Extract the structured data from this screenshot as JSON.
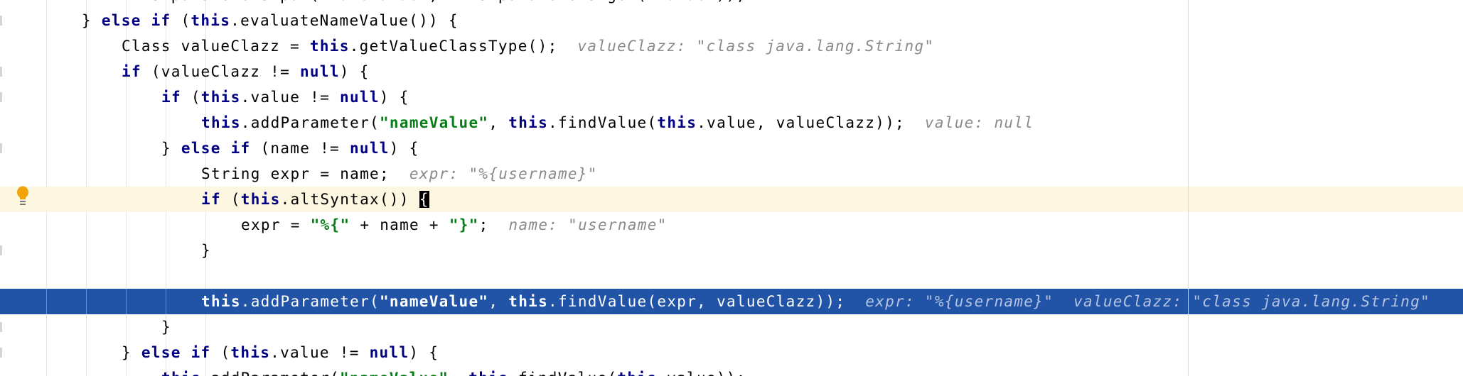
{
  "editor": {
    "lines": [
      {
        "indent": 2,
        "tokens": [
          {
            "s": "kw",
            "t": "this"
          },
          {
            "s": "plain",
            "t": ".parameters.put("
          },
          {
            "s": "str",
            "t": "\"nameValue\""
          },
          {
            "s": "plain",
            "t": ", "
          },
          {
            "s": "kw",
            "t": "this"
          },
          {
            "s": "plain",
            "t": ".parameters.get("
          },
          {
            "s": "str",
            "t": "\"value\""
          },
          {
            "s": "plain",
            "t": "));"
          }
        ]
      },
      {
        "indent": 1,
        "tokens": [
          {
            "s": "plain",
            "t": "} "
          },
          {
            "s": "kw",
            "t": "else if"
          },
          {
            "s": "plain",
            "t": " ("
          },
          {
            "s": "kw",
            "t": "this"
          },
          {
            "s": "plain",
            "t": ".evaluateNameValue()) {"
          }
        ]
      },
      {
        "indent": 2,
        "tokens": [
          {
            "s": "plain",
            "t": "Class valueClazz = "
          },
          {
            "s": "kw",
            "t": "this"
          },
          {
            "s": "plain",
            "t": ".getValueClassType();  "
          },
          {
            "s": "hint",
            "t": "valueClazz: \"class java.lang.String\""
          }
        ]
      },
      {
        "indent": 2,
        "tokens": [
          {
            "s": "kw",
            "t": "if"
          },
          {
            "s": "plain",
            "t": " (valueClazz != "
          },
          {
            "s": "kw",
            "t": "null"
          },
          {
            "s": "plain",
            "t": ") {"
          }
        ]
      },
      {
        "indent": 3,
        "tokens": [
          {
            "s": "kw",
            "t": "if"
          },
          {
            "s": "plain",
            "t": " ("
          },
          {
            "s": "kw",
            "t": "this"
          },
          {
            "s": "plain",
            "t": ".value != "
          },
          {
            "s": "kw",
            "t": "null"
          },
          {
            "s": "plain",
            "t": ") {"
          }
        ]
      },
      {
        "indent": 4,
        "tokens": [
          {
            "s": "kw",
            "t": "this"
          },
          {
            "s": "plain",
            "t": ".addParameter("
          },
          {
            "s": "str",
            "t": "\"nameValue\""
          },
          {
            "s": "plain",
            "t": ", "
          },
          {
            "s": "kw",
            "t": "this"
          },
          {
            "s": "plain",
            "t": ".findValue("
          },
          {
            "s": "kw",
            "t": "this"
          },
          {
            "s": "plain",
            "t": ".value, valueClazz));  "
          },
          {
            "s": "hint",
            "t": "value: null"
          }
        ]
      },
      {
        "indent": 3,
        "tokens": [
          {
            "s": "plain",
            "t": "} "
          },
          {
            "s": "kw",
            "t": "else if"
          },
          {
            "s": "plain",
            "t": " (name != "
          },
          {
            "s": "kw",
            "t": "null"
          },
          {
            "s": "plain",
            "t": ") {"
          }
        ]
      },
      {
        "indent": 4,
        "tokens": [
          {
            "s": "plain",
            "t": "String expr = name;  "
          },
          {
            "s": "hint",
            "t": "expr: \"%{username}\""
          }
        ]
      },
      {
        "indent": 4,
        "caret": true,
        "tokens": [
          {
            "s": "kw",
            "t": "if"
          },
          {
            "s": "plain",
            "t": " ("
          },
          {
            "s": "kw",
            "t": "this"
          },
          {
            "s": "plain",
            "t": ".altSyntax()) "
          },
          {
            "s": "cursor",
            "t": "{"
          }
        ]
      },
      {
        "indent": 5,
        "tokens": [
          {
            "s": "plain",
            "t": "expr = "
          },
          {
            "s": "str",
            "t": "\"%{\""
          },
          {
            "s": "plain",
            "t": " + name + "
          },
          {
            "s": "str",
            "t": "\"}\""
          },
          {
            "s": "plain",
            "t": ";  "
          },
          {
            "s": "hint",
            "t": "name: \"username\""
          }
        ]
      },
      {
        "indent": 4,
        "tokens": [
          {
            "s": "plain",
            "t": "}"
          }
        ]
      },
      {
        "indent": 4,
        "tokens": []
      },
      {
        "indent": 4,
        "selected": true,
        "tokens": [
          {
            "s": "kw",
            "t": "this"
          },
          {
            "s": "plain",
            "t": ".addParameter("
          },
          {
            "s": "str",
            "t": "\"nameValue\""
          },
          {
            "s": "plain",
            "t": ", "
          },
          {
            "s": "kw",
            "t": "this"
          },
          {
            "s": "plain",
            "t": ".findValue(expr, valueClazz));  "
          },
          {
            "s": "hint",
            "t": "expr: \"%{username}\""
          },
          {
            "s": "plain",
            "t": "  "
          },
          {
            "s": "hint",
            "t": "valueClazz: \"class java.lang.String\""
          }
        ]
      },
      {
        "indent": 3,
        "tokens": [
          {
            "s": "plain",
            "t": "}"
          }
        ]
      },
      {
        "indent": 2,
        "tokens": [
          {
            "s": "plain",
            "t": "} "
          },
          {
            "s": "kw",
            "t": "else if"
          },
          {
            "s": "plain",
            "t": " ("
          },
          {
            "s": "kw",
            "t": "this"
          },
          {
            "s": "plain",
            "t": ".value != "
          },
          {
            "s": "kw",
            "t": "null"
          },
          {
            "s": "plain",
            "t": ") {"
          }
        ]
      },
      {
        "indent": 3,
        "tokens": [
          {
            "s": "kw",
            "t": "this"
          },
          {
            "s": "plain",
            "t": ".addParameter("
          },
          {
            "s": "str",
            "t": "\"nameValue\""
          },
          {
            "s": "plain",
            "t": ", "
          },
          {
            "s": "kw",
            "t": "this"
          },
          {
            "s": "plain",
            "t": ".findValue("
          },
          {
            "s": "kw",
            "t": "this"
          },
          {
            "s": "plain",
            "t": ".value));"
          }
        ]
      }
    ],
    "intention_icon": "lightbulb-icon"
  }
}
